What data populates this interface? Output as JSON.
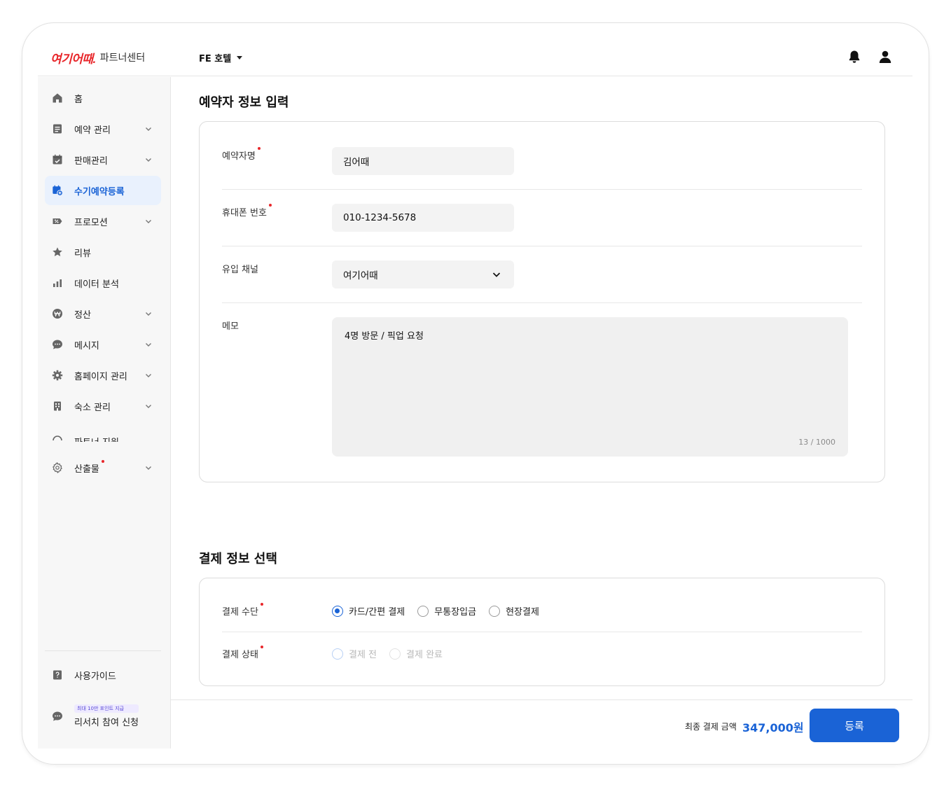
{
  "header": {
    "brand": "여기어때.",
    "brand_sub": "파트너센터",
    "hotel_name": "FE 호텔",
    "bell_icon": "bell-icon",
    "user_icon": "user-icon"
  },
  "sidebar": {
    "items": [
      {
        "label": "홈",
        "icon": "home-icon",
        "expandable": false
      },
      {
        "label": "예약 관리",
        "icon": "document-icon",
        "expandable": true
      },
      {
        "label": "판매관리",
        "icon": "calendar-check-icon",
        "expandable": true
      },
      {
        "label": "수기예약등록",
        "icon": "calendar-plus-icon",
        "expandable": false,
        "active": true
      },
      {
        "label": "프로모션",
        "icon": "discount-tag-icon",
        "expandable": true
      },
      {
        "label": "리뷰",
        "icon": "star-icon",
        "expandable": false
      },
      {
        "label": "데이터 분석",
        "icon": "bar-chart-icon",
        "expandable": false
      },
      {
        "label": "정산",
        "icon": "won-coin-icon",
        "expandable": true
      },
      {
        "label": "메시지",
        "icon": "chat-bubble-icon",
        "expandable": true
      },
      {
        "label": "홈페이지 관리",
        "icon": "gear-icon",
        "expandable": true
      },
      {
        "label": "숙소 관리",
        "icon": "building-icon",
        "expandable": true
      },
      {
        "label": "파트너 지원",
        "icon": "support-icon",
        "expandable": false
      },
      {
        "label": "산출물",
        "icon": "gear-outline-icon",
        "expandable": true
      }
    ],
    "guide_label": "사용가이드",
    "research_badge": "최대 10만 포인트 지급",
    "research_label": "리서치 참여 신청"
  },
  "booker": {
    "title": "예약자 정보 입력",
    "name_label": "예약자명",
    "name_value": "김어때",
    "phone_label": "휴대폰 번호",
    "phone_value": "010-1234-5678",
    "channel_label": "유입 채널",
    "channel_value": "여기어때",
    "memo_label": "메모",
    "memo_value": "4명 방문 / 픽업 요청",
    "memo_count": "13 / 1000"
  },
  "payment": {
    "title": "결제 정보 선택",
    "method_label": "결제 수단",
    "methods": [
      "카드/간편 결제",
      "무통장입금",
      "현장결제"
    ],
    "selected_method": "카드/간편 결제",
    "status_label": "결제 상태",
    "statuses": [
      "결제 전",
      "결제 완료"
    ],
    "selected_status": "결제 전"
  },
  "footer": {
    "total_label": "최종 결제 금액",
    "total_value": "347,000원",
    "submit_label": "등록"
  },
  "colors": {
    "accent": "#1a63d6",
    "brand_red": "#e8272b",
    "sidebar_bg": "#f7f7f7",
    "active_bg": "#e9f1fd"
  }
}
